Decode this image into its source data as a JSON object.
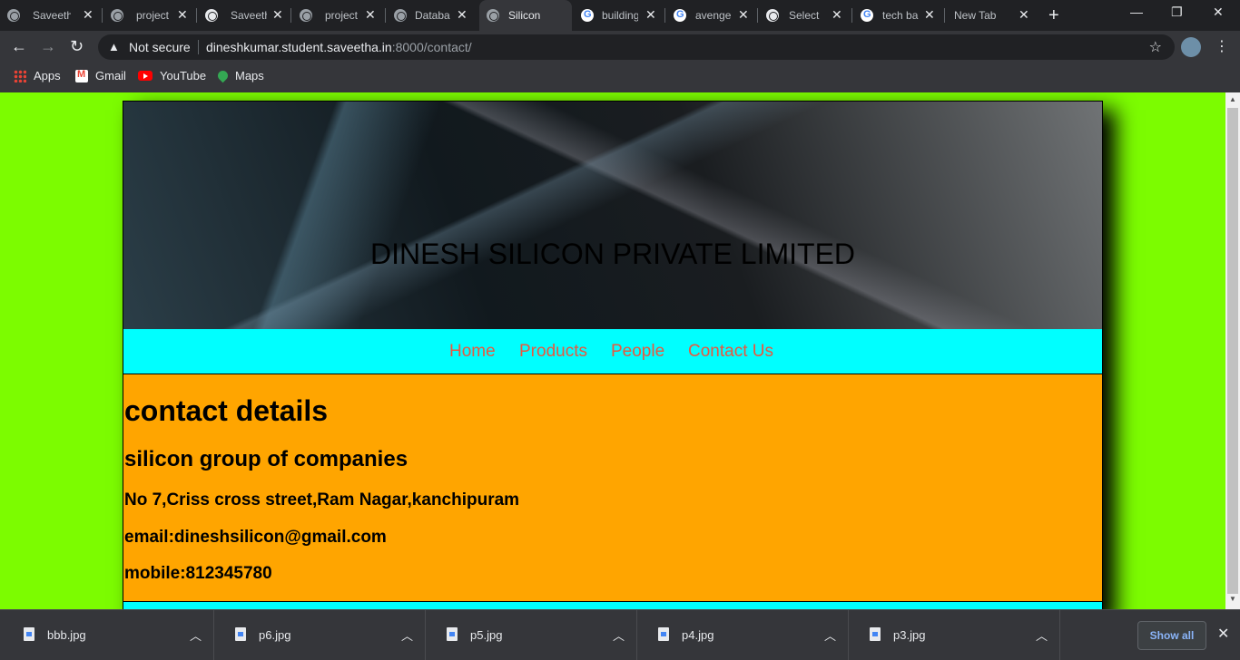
{
  "browser": {
    "tabs": [
      {
        "title": "Saveeth",
        "icon": "globe-icon"
      },
      {
        "title": "project",
        "icon": "globe-icon"
      },
      {
        "title": "Saveeth",
        "icon": "globe-icon"
      },
      {
        "title": "project",
        "icon": "globe-icon"
      },
      {
        "title": "Databa",
        "icon": "globe-icon"
      },
      {
        "title": "Silicon",
        "icon": "globe-icon",
        "active": true
      },
      {
        "title": "building",
        "icon": "google-icon"
      },
      {
        "title": "avenge",
        "icon": "google-icon"
      },
      {
        "title": "Select p",
        "icon": "globe-icon"
      },
      {
        "title": "tech ba",
        "icon": "google-icon"
      },
      {
        "title": "New Tab",
        "icon": ""
      }
    ],
    "security_label": "Not secure",
    "url_host": "dineshkumar.student.saveetha.in",
    "url_rest": ":8000/contact/",
    "bookmarks": [
      "Apps",
      "Gmail",
      "YouTube",
      "Maps"
    ]
  },
  "site": {
    "company_name": "DINESH SILICON PRIVATE LIMITED",
    "nav": [
      "Home",
      "Products",
      "People",
      "Contact Us"
    ],
    "heading": "contact details",
    "subheading": "silicon group of companies",
    "address": "No 7,Criss cross street,Ram Nagar,kanchipuram",
    "email": "email:dineshsilicon@gmail.com",
    "mobile": "mobile:812345780",
    "colors": {
      "page_bg": "#7cfc00",
      "nav_bg": "#00ffff",
      "content_bg": "#ffa500",
      "nav_link": "#e9573f"
    }
  },
  "downloads": {
    "files": [
      "bbb.jpg",
      "p6.jpg",
      "p5.jpg",
      "p4.jpg",
      "p3.jpg"
    ],
    "show_all_label": "Show all"
  }
}
